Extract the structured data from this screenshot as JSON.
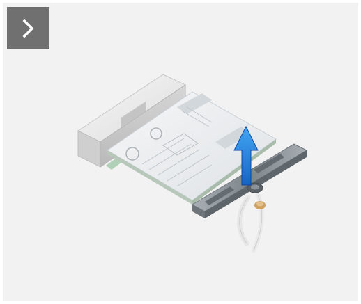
{
  "navigation": {
    "next_button_icon": "chevron-right-icon"
  },
  "illustration": {
    "subject": "wireless-card-removal",
    "arrow_direction": "up",
    "colors": {
      "background": "#f2f2f2",
      "button": "#707070",
      "arrow": "#1e88e5",
      "card": "#e9ecee",
      "bracket": "#8c9399"
    }
  }
}
